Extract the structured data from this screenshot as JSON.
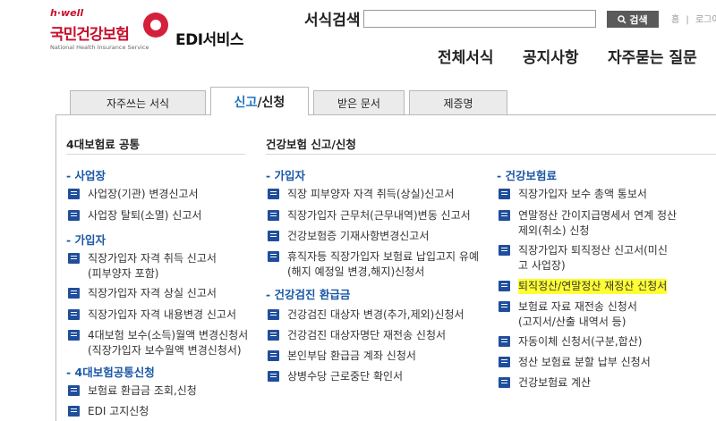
{
  "logo": {
    "hwell": "h·well",
    "name": "국민건강보험",
    "sub": "National Health Insurance Service",
    "edi": "EDI서비스"
  },
  "search": {
    "label": "서식검색",
    "value": "",
    "button": "검색",
    "icon": "search-icon"
  },
  "util": {
    "home": "홈",
    "sep": "|",
    "login": "로그아웃"
  },
  "topnav": [
    "전체서식",
    "공지사항",
    "자주묻는 질문"
  ],
  "tabs": [
    {
      "label": "자주쓰는 서식"
    },
    {
      "label_a": "신고",
      "label_b": "/신청"
    },
    {
      "label": "받은 문서"
    },
    {
      "label": "제증명"
    }
  ],
  "col1": {
    "heading": "4대보험료 공통",
    "sections": [
      {
        "title": "- 사업장",
        "items": [
          "사업장(기관) 변경신고서",
          "사업장 탈퇴(소멸) 신고서"
        ]
      },
      {
        "title": "- 가입자",
        "items": [
          "직장가입자 자격 취득 신고서\n(피부양자 포함)",
          "직장가입자 자격 상실 신고서",
          "직장가입자 자격 내용변경 신고서",
          "4대보험 보수(소득)월액 변경신청서\n(직장가입자 보수월액 변경신청서)"
        ]
      },
      {
        "title": "- 4대보험공통신청",
        "items": [
          "보험료 환급금 조회,신청",
          "EDI 고지신청"
        ]
      }
    ]
  },
  "col2": {
    "heading": "건강보험 신고/신청",
    "sections": [
      {
        "title": "- 가입자",
        "items": [
          "직장 피부양자 자격 취득(상실)신고서",
          "직장가입자 근무처(근무내역)변동 신고서",
          "건강보험증 기재사항변경신고서",
          "휴직자등 직장가입자 보험료 납입고지 유예\n(해지 예정일 변경,해지)신청서"
        ]
      },
      {
        "title": "- 건강검진 환급금",
        "items": [
          "건강검진 대상자 변경(추가,제외)신청서",
          "건강검진 대상자명단 재전송 신청서",
          "본인부담 환급금 계좌 신청서",
          "상병수당 근로중단 확인서"
        ]
      }
    ]
  },
  "col3": {
    "sections": [
      {
        "title": "- 건강보험료",
        "items": [
          "직장가입자 보수 총액 통보서",
          "연말정산 간이지급명세서 연계 정산\n제외(취소) 신청",
          "직장가입자 퇴직정산 신고서(미신\n고 사업장)",
          "퇴직정산/연말정산 재정산 신청서",
          "보험료 자료 재전송 신청서\n(고지서/산출 내역서 등)",
          "자동이체 신청서(구분,합산)",
          "정산 보험료 분할 납부 신청서",
          "건강보험료 계산"
        ]
      }
    ]
  },
  "highlight_color": "#ffff33",
  "icon_color": "#1f4e9c",
  "section_color": "#1a57a6"
}
